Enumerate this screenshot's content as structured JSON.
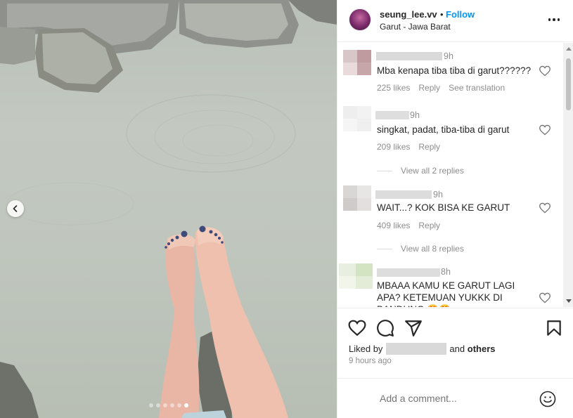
{
  "post": {
    "username": "seung_lee.vv",
    "separator": "•",
    "follow_label": "Follow",
    "location": "Garut - Jawa Barat",
    "carousel": {
      "dot_count": 6,
      "active_index": 5
    }
  },
  "comments": [
    {
      "time": "9h",
      "text": "Mba kenapa tiba tiba di garut??????",
      "likes": "225 likes",
      "reply_label": "Reply",
      "translate_label": "See translation",
      "replies_label": ""
    },
    {
      "time": "9h",
      "text": "singkat, padat, tiba-tiba di garut",
      "likes": "209 likes",
      "reply_label": "Reply",
      "translate_label": "",
      "replies_label": "View all 2 replies"
    },
    {
      "time": "9h",
      "text": "WAIT...? KOK BISA KE GARUT",
      "likes": "409 likes",
      "reply_label": "Reply",
      "translate_label": "",
      "replies_label": "View all 8 replies"
    },
    {
      "time": "8h",
      "text": "MBAAA KAMU KE GARUT LAGI APA? KETEMUAN YUKKK DI BANDUNG 😍😍",
      "likes": "",
      "reply_label": "",
      "translate_label": "",
      "replies_label": ""
    }
  ],
  "footer": {
    "liked_by_prefix": "Liked by",
    "liked_by_suffix_and": "and",
    "liked_by_others": "others",
    "time_ago": "9 hours ago",
    "add_comment_placeholder": "Add a comment..."
  },
  "icons": {
    "like": "heart-icon",
    "comment": "comment-icon",
    "share": "share-icon",
    "save": "bookmark-icon",
    "emoji": "emoji-icon",
    "more": "more-options-icon",
    "prev": "chevron-left-icon"
  },
  "colors": {
    "accent": "#0095f6",
    "text": "#262626",
    "secondary_text": "#8e8e8e",
    "border": "#efefef",
    "water": "#c3c9c1"
  }
}
